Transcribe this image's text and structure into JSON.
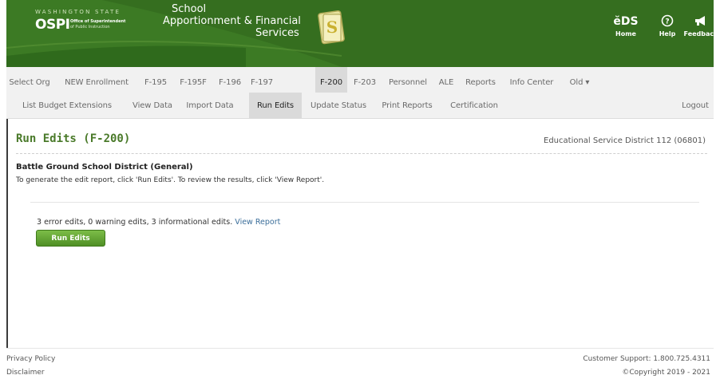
{
  "header": {
    "state_text": "WASHINGTON STATE",
    "ospi": "OSPI",
    "ospi_line1": "Office of Superintendent",
    "ospi_line2": "of Public Instruction",
    "app_title_line1": "School",
    "app_title_line2": "Apportionment & Financial",
    "app_title_line3": "Services",
    "home_label": "Home",
    "help_label": "Help",
    "feedback_label": "Feedback",
    "home_icon_text": "ĕDS",
    "colors": {
      "banner": "#3c7a24",
      "banner_dark": "#24541a"
    }
  },
  "nav_primary": [
    {
      "label": "Select Org"
    },
    {
      "label": "NEW Enrollment"
    },
    {
      "label": "F-195"
    },
    {
      "label": "F-195F"
    },
    {
      "label": "F-196"
    },
    {
      "label": "F-197"
    },
    {
      "label": "F-200",
      "active": true
    },
    {
      "label": "F-203"
    },
    {
      "label": "Personnel"
    },
    {
      "label": "ALE"
    },
    {
      "label": "Reports"
    },
    {
      "label": "Info Center"
    },
    {
      "label": "Old ▾"
    }
  ],
  "nav_secondary": [
    {
      "label": "List Budget Extensions"
    },
    {
      "label": "View Data"
    },
    {
      "label": "Import Data"
    },
    {
      "label": "Run Edits",
      "active": true
    },
    {
      "label": "Update Status"
    },
    {
      "label": "Print Reports"
    },
    {
      "label": "Certification"
    },
    {
      "label": "Logout"
    }
  ],
  "main": {
    "page_title": "Run Edits (F-200)",
    "org": "Educational Service District 112 (06801)",
    "district": "Battle Ground School District (General)",
    "instructions": "To generate the edit report, click 'Run Edits'. To review the results, click 'View Report'.",
    "summary": "3 error edits, 0 warning edits, 3 informational edits.",
    "view_report_label": "View Report",
    "run_edits_label": "Run Edits",
    "accent_color": "#4a7a2a"
  },
  "footer": {
    "privacy": "Privacy Policy",
    "disclaimer": "Disclaimer",
    "support": "Customer Support: 1.800.725.4311",
    "copyright": "©Copyright 2019 - 2021"
  }
}
